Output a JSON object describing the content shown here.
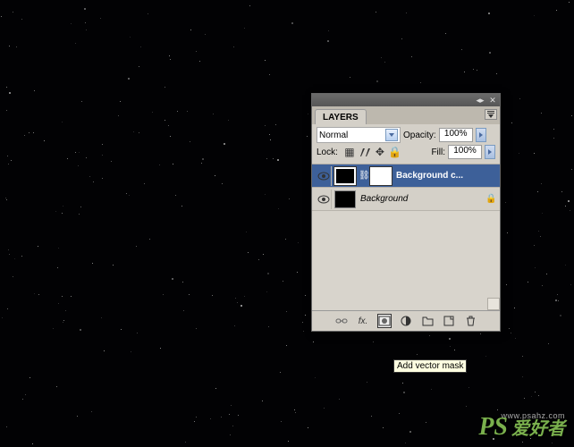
{
  "panel": {
    "title_tab": "LAYERS",
    "blend_mode": "Normal",
    "opacity_label": "Opacity:",
    "opacity_value": "100%",
    "lock_label": "Lock:",
    "fill_label": "Fill:",
    "fill_value": "100%"
  },
  "layers": [
    {
      "name": "Background c...",
      "selected": true,
      "has_mask": true,
      "locked": false,
      "italic": false
    },
    {
      "name": "Background",
      "selected": false,
      "has_mask": false,
      "locked": true,
      "italic": true
    }
  ],
  "bottom_icons": {
    "link": "link-icon",
    "fx": "fx.",
    "mask": "mask-icon",
    "adjust": "adjust-icon",
    "group": "group-icon",
    "new": "new-icon",
    "trash": "trash-icon"
  },
  "tooltip": "Add vector mask",
  "watermark": {
    "logo": "PS",
    "text": "爱好者"
  },
  "url": "www.psahz.com"
}
